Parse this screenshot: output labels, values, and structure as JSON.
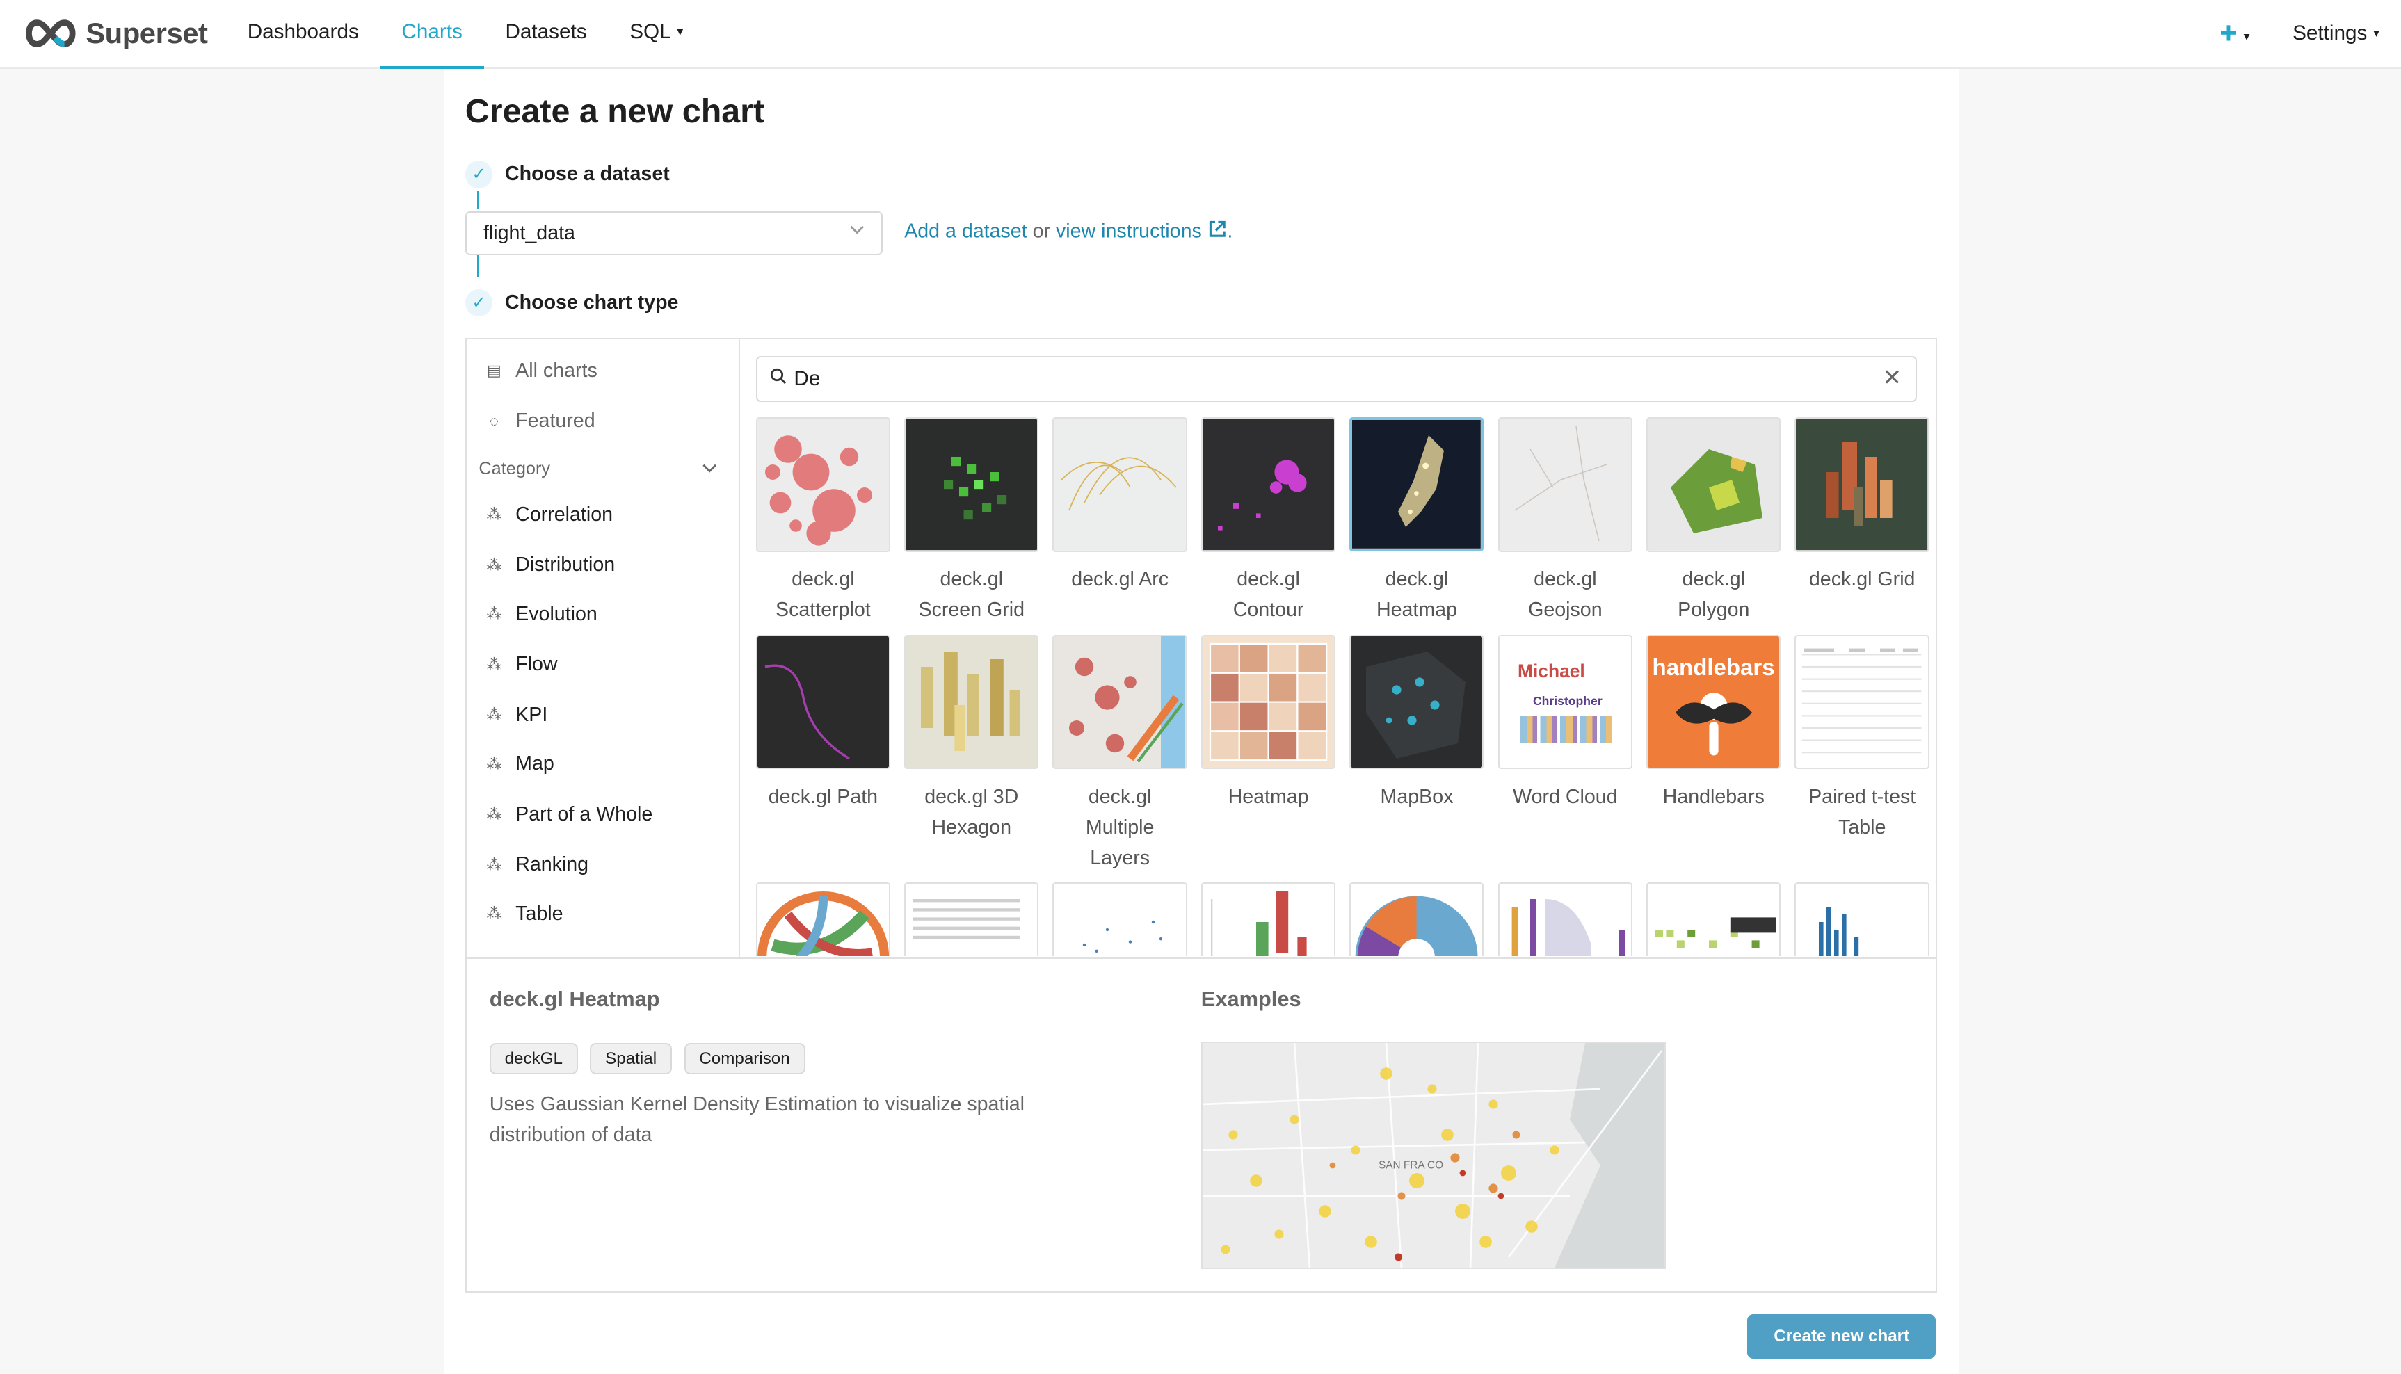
{
  "navbar": {
    "brand": "Superset",
    "items": [
      {
        "label": "Dashboards"
      },
      {
        "label": "Charts"
      },
      {
        "label": "Datasets"
      },
      {
        "label": "SQL"
      }
    ],
    "settings_label": "Settings"
  },
  "page": {
    "title": "Create a new chart",
    "step1_label": "Choose a dataset",
    "step2_label": "Choose chart type",
    "dataset_value": "flight_data",
    "add_dataset_link": "Add a dataset",
    "or_text": "or",
    "view_instructions_link": "view instructions",
    "period": "."
  },
  "sidebar": {
    "all_charts": "All charts",
    "featured": "Featured",
    "category_label": "Category",
    "categories": [
      "Correlation",
      "Distribution",
      "Evolution",
      "Flow",
      "KPI",
      "Map",
      "Part of a Whole",
      "Ranking",
      "Table"
    ]
  },
  "search": {
    "value": "De"
  },
  "charts": [
    {
      "line1": "deck.gl",
      "line2": "Scatterplot"
    },
    {
      "line1": "deck.gl",
      "line2": "Screen Grid"
    },
    {
      "line1": "deck.gl Arc",
      "line2": ""
    },
    {
      "line1": "deck.gl",
      "line2": "Contour"
    },
    {
      "line1": "deck.gl",
      "line2": "Heatmap"
    },
    {
      "line1": "deck.gl",
      "line2": "Geojson"
    },
    {
      "line1": "deck.gl",
      "line2": "Polygon"
    },
    {
      "line1": "deck.gl Grid",
      "line2": ""
    },
    {
      "line1": "deck.gl Path",
      "line2": ""
    },
    {
      "line1": "deck.gl 3D",
      "line2": "Hexagon"
    },
    {
      "line1": "deck.gl",
      "line2": "Multiple",
      "line3": "Layers"
    },
    {
      "line1": "Heatmap",
      "line2": ""
    },
    {
      "line1": "MapBox",
      "line2": ""
    },
    {
      "line1": "Word Cloud",
      "line2": ""
    },
    {
      "line1": "Handlebars",
      "line2": ""
    },
    {
      "line1": "Paired t-test",
      "line2": "Table"
    }
  ],
  "thumb_text": {
    "handlebars": "handlebars",
    "wordcloud_1": "Michael",
    "wordcloud_2": "Christopher"
  },
  "detail": {
    "title": "deck.gl Heatmap",
    "tags": [
      "deckGL",
      "Spatial",
      "Comparison"
    ],
    "description": "Uses Gaussian Kernel Density Estimation to visualize spatial distribution of data",
    "examples_label": "Examples",
    "example_map_label": "SAN FRA CO"
  },
  "create_button": "Create new chart",
  "colors": {
    "accent": "#20a7c9",
    "link": "#1f87ad",
    "button": "#4fa0c4"
  }
}
